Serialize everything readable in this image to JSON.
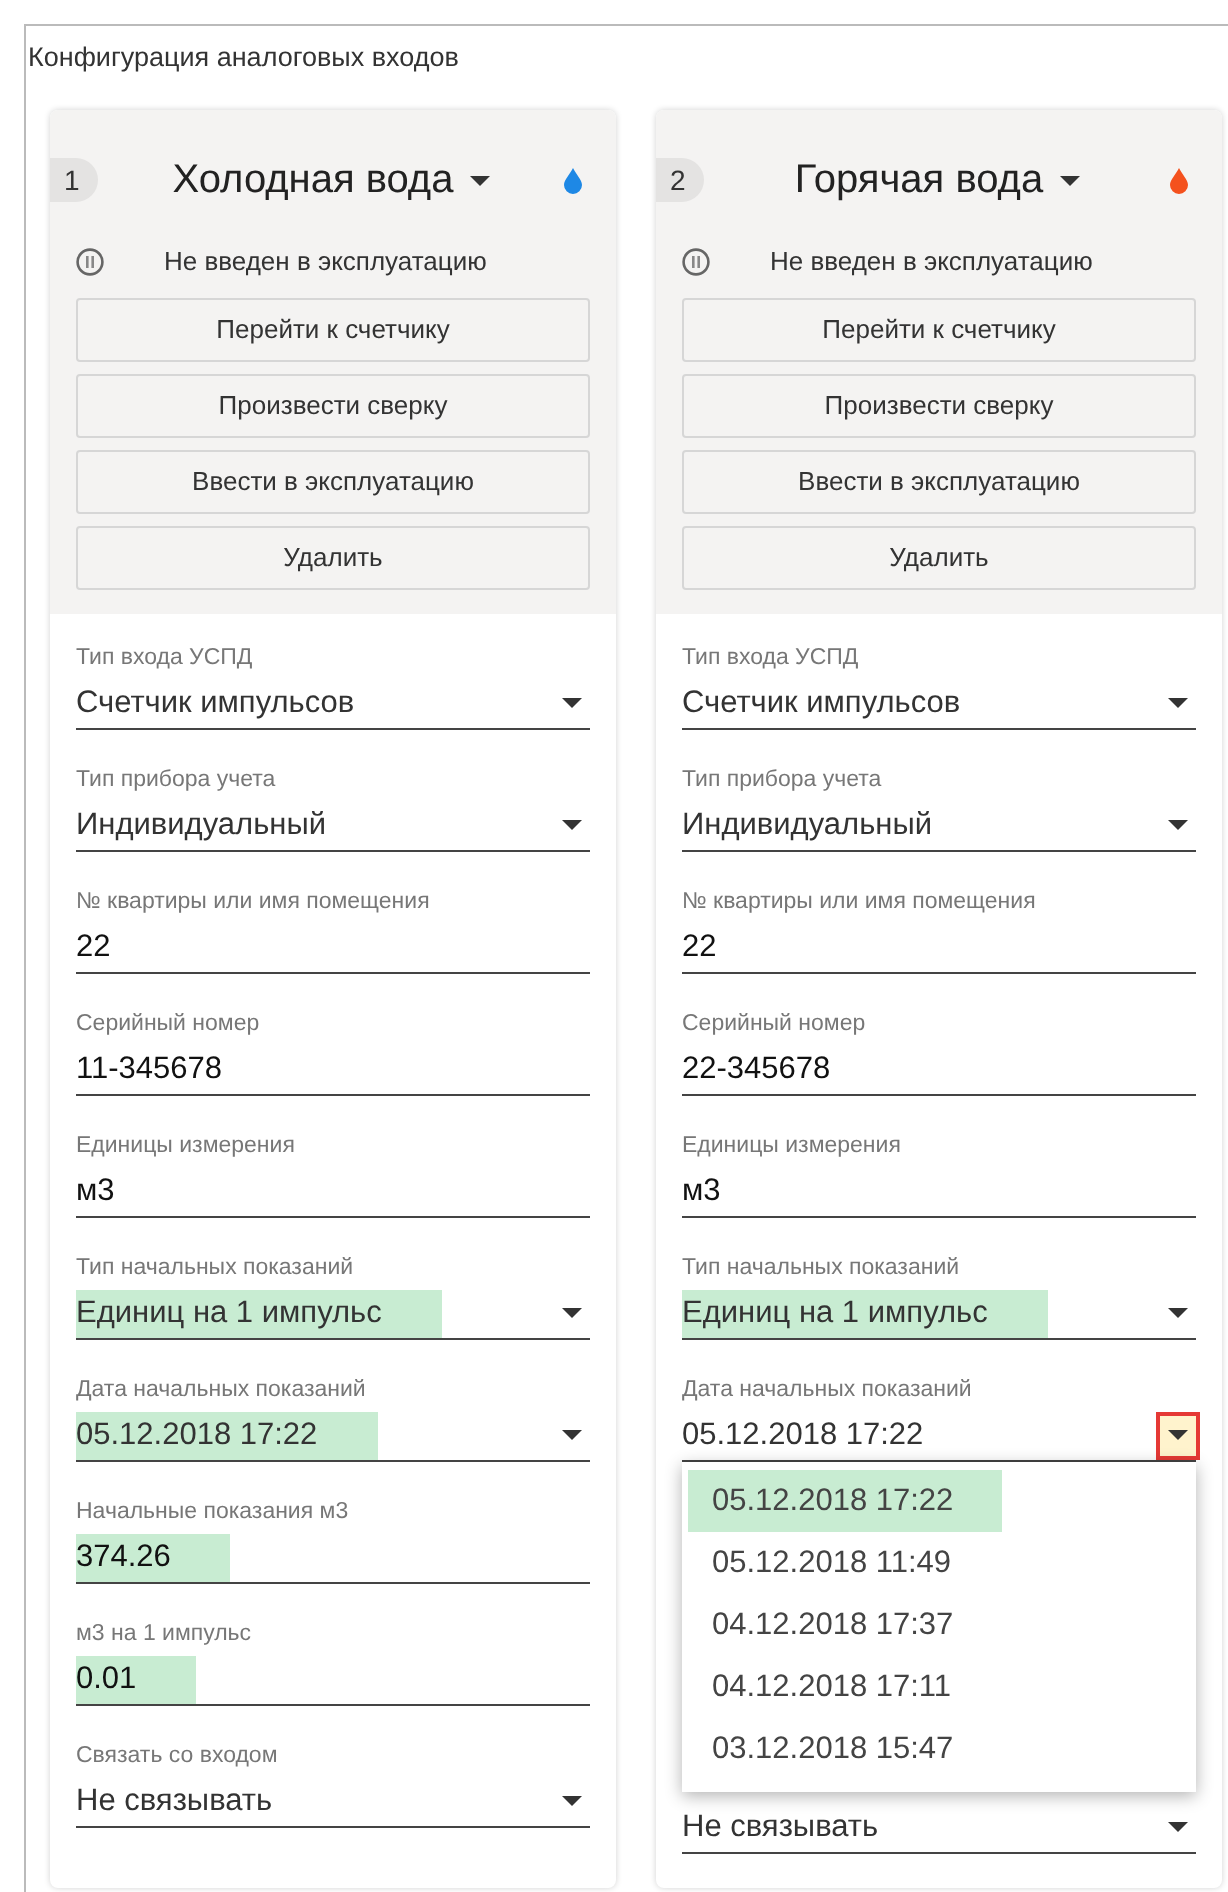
{
  "panel": {
    "title": "Конфигурация аналоговых входов"
  },
  "inputs": [
    {
      "number": "1",
      "name": "Холодная вода",
      "color": "#1e88e5",
      "status": "Не введен в эксплуатацию",
      "buttons": [
        "Перейти к счетчику",
        "Произвести сверку",
        "Ввести в эксплуатацию",
        "Удалить"
      ],
      "fields": [
        {
          "kind": "select",
          "label": "Тип входа УСПД",
          "value": "Счетчик импульсов",
          "highlighted": false
        },
        {
          "kind": "select",
          "label": "Тип прибора учета",
          "value": "Индивидуальный",
          "highlighted": false
        },
        {
          "kind": "text",
          "label": "№ квартиры или имя помещения",
          "value": "22",
          "highlighted": false
        },
        {
          "kind": "text",
          "label": "Серийный номер",
          "value": "11-345678",
          "highlighted": false
        },
        {
          "kind": "text",
          "label": "Единицы измерения",
          "value": "м3",
          "highlighted": false
        },
        {
          "kind": "select",
          "label": "Тип начальных показаний",
          "value": "Единиц на 1 импульс",
          "highlighted": true
        },
        {
          "kind": "select",
          "label": "Дата начальных показаний",
          "value": "05.12.2018 17:22",
          "highlighted": true
        },
        {
          "kind": "text",
          "label": "Начальные показания м3",
          "value": "374.26",
          "highlighted": true
        },
        {
          "kind": "text",
          "label": "м3 на 1 импульс",
          "value": "0.01",
          "highlighted": true
        },
        {
          "kind": "select",
          "label": "Связать со входом",
          "value": "Не связывать",
          "highlighted": false
        }
      ]
    },
    {
      "number": "2",
      "name": "Горячая вода",
      "color": "#f4511e",
      "status": "Не введен в эксплуатацию",
      "buttons": [
        "Перейти к счетчику",
        "Произвести сверку",
        "Ввести в эксплуатацию",
        "Удалить"
      ],
      "fields": [
        {
          "kind": "select",
          "label": "Тип входа УСПД",
          "value": "Счетчик импульсов",
          "highlighted": false
        },
        {
          "kind": "select",
          "label": "Тип прибора учета",
          "value": "Индивидуальный",
          "highlighted": false
        },
        {
          "kind": "text",
          "label": "№ квартиры или имя помещения",
          "value": "22",
          "highlighted": false
        },
        {
          "kind": "text",
          "label": "Серийный номер",
          "value": "22-345678",
          "highlighted": false
        },
        {
          "kind": "text",
          "label": "Единицы измерения",
          "value": "м3",
          "highlighted": false
        },
        {
          "kind": "select",
          "label": "Тип начальных показаний",
          "value": "Единиц на 1 импульс",
          "highlighted": true
        },
        {
          "kind": "select",
          "label": "Дата начальных показаний",
          "value": "05.12.2018 17:22",
          "highlighted": false,
          "caret_marked": true,
          "expanded": true,
          "options": [
            {
              "label": "05.12.2018 17:22",
              "selected": true
            },
            {
              "label": "05.12.2018 11:49",
              "selected": false
            },
            {
              "label": "04.12.2018 17:37",
              "selected": false
            },
            {
              "label": "04.12.2018 17:11",
              "selected": false
            },
            {
              "label": "03.12.2018 15:47",
              "selected": false
            }
          ]
        },
        {
          "kind": "select",
          "value": "Не связывать",
          "highlighted": false
        }
      ]
    }
  ]
}
